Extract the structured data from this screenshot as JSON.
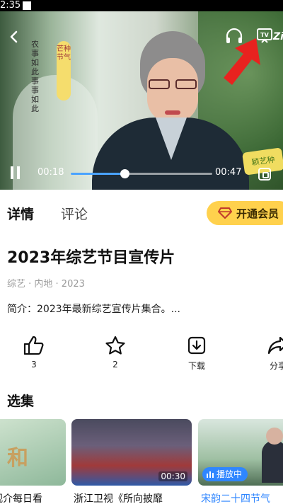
{
  "status_bar": {
    "time": "2:35"
  },
  "player": {
    "calligraphy_left": "农事如此 事事如此",
    "badge_text": "芒种节气",
    "brand_sticker": "颖艺种",
    "tv_suffix": "Zi",
    "current_time": "00:18",
    "total_time": "00:47",
    "progress": 0.38,
    "arrow_color": "#e8221f"
  },
  "tabs": {
    "detail": "详情",
    "comment": "评论",
    "vip": "开通会员"
  },
  "info": {
    "title": "2023年综艺节目宣传片",
    "meta": "综艺 · 内地 · 2023",
    "description": "简介：2023年最新综艺宣传片集合。..."
  },
  "actions": {
    "like": {
      "icon": "thumbs-up-icon",
      "label": "3"
    },
    "favorite": {
      "icon": "star-icon",
      "label": "2"
    },
    "download": {
      "icon": "download-icon",
      "label": "下载"
    },
    "share": {
      "icon": "share-icon",
      "label": "分享"
    }
  },
  "episodes": {
    "heading": "选集",
    "items": [
      {
        "title": "观介每日看",
        "thumb_text": "和"
      },
      {
        "title": "浙江卫视《所向披靡",
        "duration": "00:30"
      },
      {
        "title": "宋韵二十四节气",
        "playing_label": "播放中"
      }
    ]
  },
  "colors": {
    "accent": "#2f86ff",
    "vip_bg": "#ffd14d",
    "progress": "#4aa3ff"
  }
}
